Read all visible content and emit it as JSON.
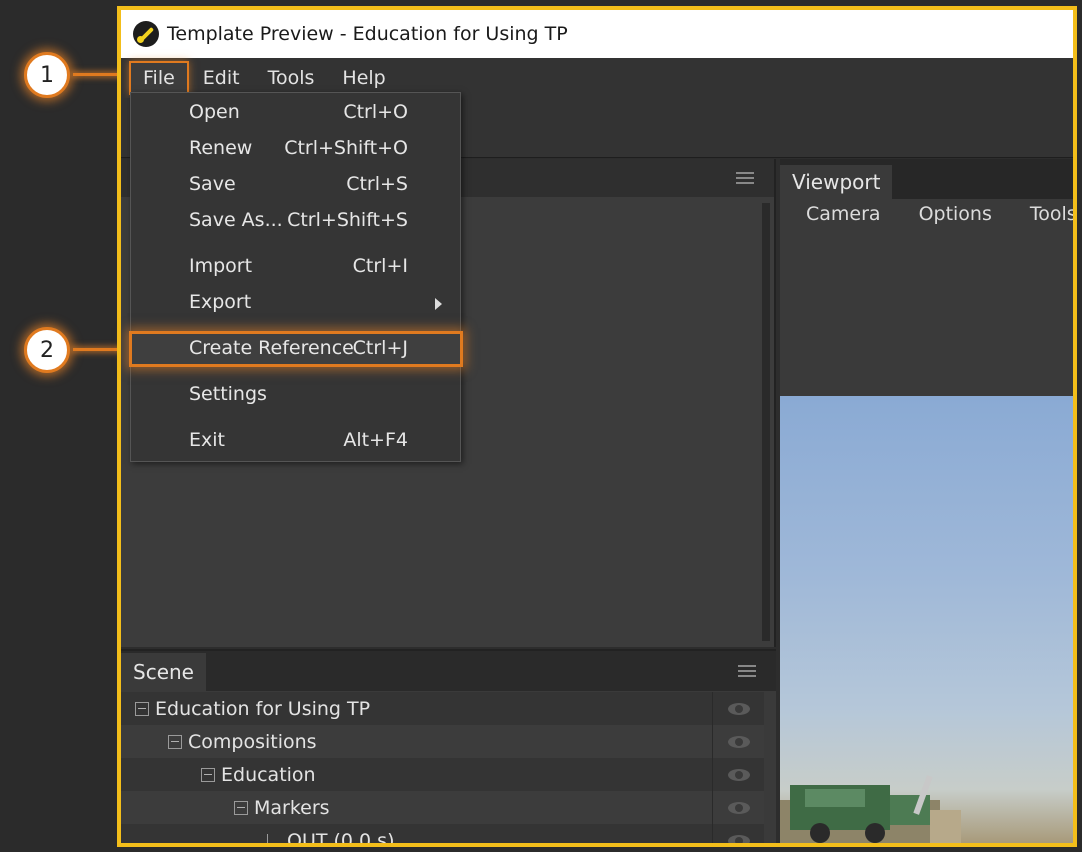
{
  "window": {
    "title": "Template Preview - Education for Using TP"
  },
  "menubar": {
    "items": [
      {
        "label": "File"
      },
      {
        "label": "Edit"
      },
      {
        "label": "Tools"
      },
      {
        "label": "Help"
      }
    ]
  },
  "file_menu": {
    "items": [
      {
        "label": "Open",
        "shortcut": "Ctrl+O"
      },
      {
        "label": "Renew",
        "shortcut": "Ctrl+Shift+O"
      },
      {
        "label": "Save",
        "shortcut": "Ctrl+S"
      },
      {
        "label": "Save As...",
        "shortcut": "Ctrl+Shift+S"
      },
      {
        "label": "Import",
        "shortcut": "Ctrl+I"
      },
      {
        "label": "Export",
        "shortcut": ""
      },
      {
        "label": "Create Reference",
        "shortcut": "Ctrl+J"
      },
      {
        "label": "Settings",
        "shortcut": ""
      },
      {
        "label": "Exit",
        "shortcut": "Alt+F4"
      }
    ]
  },
  "viewport": {
    "tab_label": "Viewport",
    "menu": [
      "Camera",
      "Options",
      "Tools"
    ]
  },
  "scene": {
    "tab_label": "Scene",
    "tree": [
      {
        "label": "Education for Using TP"
      },
      {
        "label": "Compositions"
      },
      {
        "label": "Education"
      },
      {
        "label": "Markers"
      },
      {
        "label": "OUT (0.0 s)"
      }
    ]
  },
  "callouts": [
    {
      "number": "1"
    },
    {
      "number": "2"
    }
  ],
  "colors": {
    "frame_highlight": "#f3be1a",
    "callout_accent": "#e07a1f"
  }
}
